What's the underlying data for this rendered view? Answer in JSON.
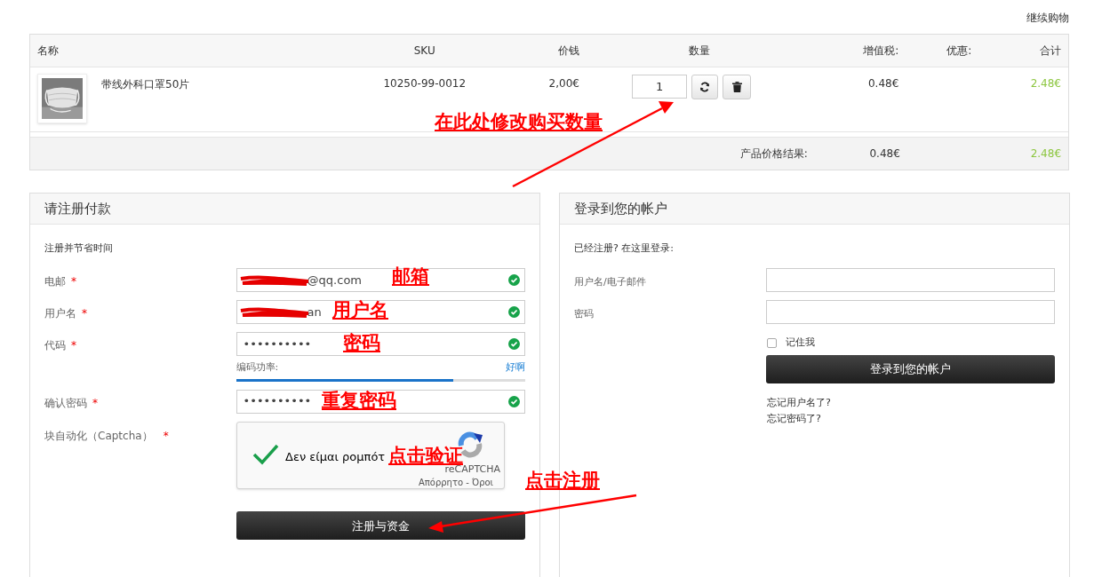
{
  "continue_link": "继续购物",
  "cart": {
    "columns": [
      "名称",
      "SKU",
      "价钱",
      "数量",
      "增值税:",
      "优惠:",
      "合计"
    ],
    "rows": [
      {
        "name": "带线外科口罩50片",
        "sku": "10250-99-0012",
        "price": "2,00€",
        "quantity": "1",
        "vat": "0.48€",
        "total": "2.48€"
      }
    ],
    "summary": {
      "label": "产品价格结果:",
      "vat": "0.48€",
      "total": "2.48€"
    }
  },
  "register": {
    "title": "请注册付款",
    "subtitle": "注册并节省时间",
    "fields": [
      {
        "label": "电邮",
        "required": "*",
        "value": "@qq.com",
        "valid": true,
        "redacted": true
      },
      {
        "label": "用户名",
        "required": "*",
        "value": "an",
        "valid": true,
        "redacted": true
      },
      {
        "label": "代码",
        "required": "*",
        "value": "••••••••••",
        "valid": true,
        "redacted": false
      }
    ],
    "strength": {
      "label": "编码功率:",
      "rating": "好啊",
      "level": 0.75
    },
    "confirm": {
      "label": "确认密码",
      "required": "*",
      "value": "••••••••••",
      "valid": true
    },
    "captcha": {
      "label": "块自动化（Captcha）",
      "required": "*",
      "checked": true,
      "text": "Δεν είμαι ρομπότ",
      "brand": "reCAPTCHA",
      "links": "Απόρρητο - Όροι"
    },
    "button": "注册与资金"
  },
  "login": {
    "title": "登录到您的帐户",
    "subtitle": "已经注册? 在这里登录:",
    "fields": [
      {
        "label": "用户名/电子邮件"
      },
      {
        "label": "密码"
      }
    ],
    "remember": {
      "label": "记住我",
      "checked": false
    },
    "button": "登录到您的帐户",
    "links": [
      "忘记用户名了?",
      "忘记密码了?"
    ]
  },
  "annotations": [
    "在此处修改购买数量",
    "邮箱",
    "用户名",
    "密码",
    "重复密码",
    "点击验证",
    "点击注册"
  ]
}
